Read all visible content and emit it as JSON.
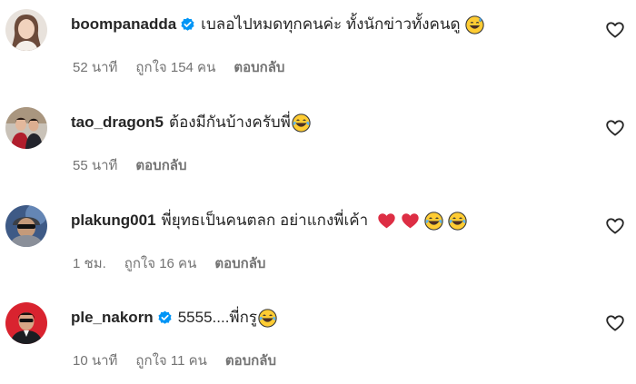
{
  "comments": [
    {
      "username": "boompanadda",
      "verified": true,
      "text": "เบลอไปหมดทุกคนค่ะ ทั้งนักข่าวทั้งคนดู",
      "emojis": [
        "sweat-smile-emoji"
      ],
      "time": "52 นาที",
      "likes": "ถูกใจ 154 คน",
      "reply": "ตอบกลับ"
    },
    {
      "username": "tao_dragon5",
      "verified": false,
      "text": "ต้องมีกันบ้างครับพี่",
      "emojis": [
        "joy-emoji"
      ],
      "time": "55 นาที",
      "likes": "",
      "reply": "ตอบกลับ"
    },
    {
      "username": "plakung001",
      "verified": false,
      "text": "พี่ยุทธเป็นคนตลก อย่าแกงพี่เค้า",
      "emojis": [
        "red-heart-emoji",
        "red-heart-emoji",
        "joy-emoji",
        "joy-emoji"
      ],
      "time": "1 ชม.",
      "likes": "ถูกใจ 16 คน",
      "reply": "ตอบกลับ"
    },
    {
      "username": "ple_nakorn",
      "verified": true,
      "text": "5555....พี่กรู",
      "emojis": [
        "joy-emoji"
      ],
      "time": "10 นาที",
      "likes": "ถูกใจ 11 คน",
      "reply": "ตอบกลับ"
    }
  ],
  "colors": {
    "text": "#262626",
    "secondary": "#737373",
    "verified": "#0095f6",
    "heart_emoji": "#e0245e"
  },
  "icons": {
    "like": "heart-outline-icon",
    "verified": "verified-badge-icon"
  }
}
